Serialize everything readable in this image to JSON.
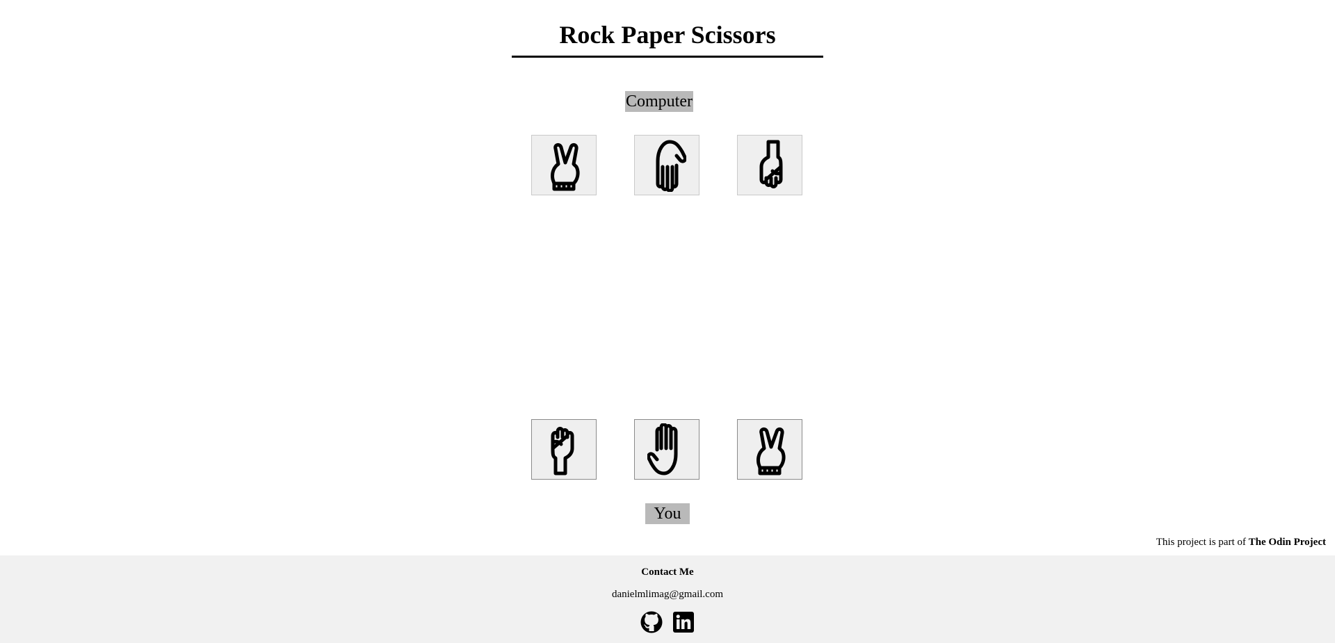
{
  "header": {
    "title": "Rock Paper Scissors"
  },
  "computer": {
    "label": "Computer",
    "choices": [
      {
        "name": "scissors",
        "icon": "scissors-hand-icon"
      },
      {
        "name": "paper",
        "icon": "paper-hand-icon"
      },
      {
        "name": "rock",
        "icon": "rock-hand-icon"
      }
    ]
  },
  "player": {
    "label": "You",
    "choices": [
      {
        "name": "rock",
        "icon": "rock-hand-icon"
      },
      {
        "name": "paper",
        "icon": "paper-hand-icon"
      },
      {
        "name": "scissors",
        "icon": "scissors-hand-icon"
      }
    ]
  },
  "credit": {
    "prefix": "This project is part of ",
    "project": "The Odin Project"
  },
  "footer": {
    "contact_title": "Contact Me",
    "email": "danielmlimag@gmail.com",
    "links": [
      {
        "icon": "github-icon"
      },
      {
        "icon": "linkedin-icon"
      }
    ]
  }
}
